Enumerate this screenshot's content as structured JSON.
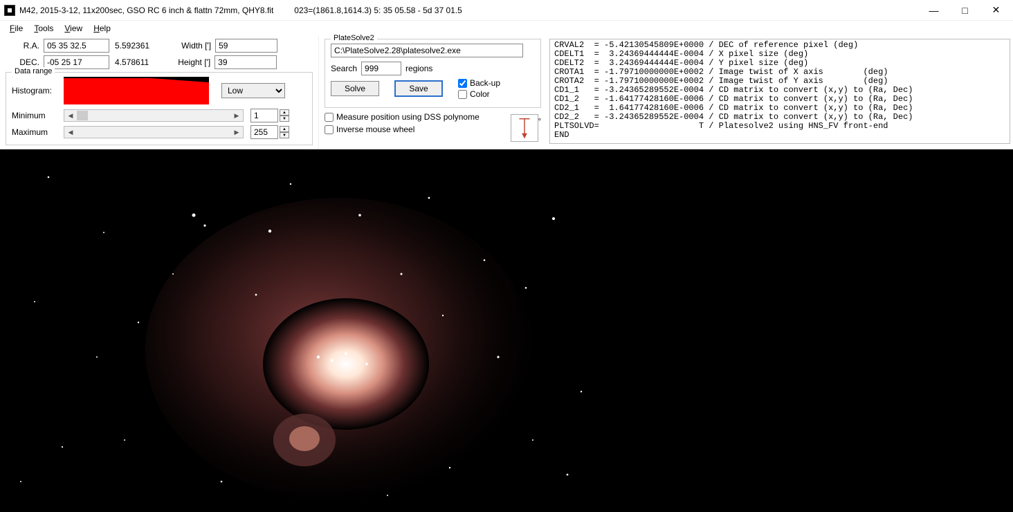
{
  "titlebar": {
    "filename": "M42, 2015-3-12,  11x200sec, GSO RC 6 inch & flattn 72mm, QHY8.fit",
    "status": "023=(1861.8,1614.3)    5: 35  05.58   - 5d 37  01.5"
  },
  "menu": {
    "file": "File",
    "tools": "Tools",
    "view": "View",
    "help": "Help"
  },
  "coords": {
    "ra_label": "R.A.",
    "ra_value": "05 35 32.5",
    "ra_decimal": "5.592361",
    "dec_label": "DEC.",
    "dec_value": "-05 25 17",
    "dec_decimal": "4.578611",
    "width_label": "Width [']",
    "width_value": "59",
    "height_label": "Height [']",
    "height_value": "39"
  },
  "datarange": {
    "legend": "Data range",
    "histogram_label": "Histogram:",
    "stretch_value": "Low",
    "min_label": "Minimum",
    "min_value": "1",
    "max_label": "Maximum",
    "max_value": "255"
  },
  "platesolve": {
    "legend": "PlateSolve2",
    "path": "C:\\PlateSolve2.28\\platesolve2.exe",
    "search_label": "Search",
    "search_value": "999",
    "regions_label": "regions",
    "solve_btn": "Solve",
    "save_btn": "Save",
    "backup_label": "Back-up",
    "backup_checked": true,
    "color_label": "Color",
    "color_checked": false,
    "dss_label": "Measure position using DSS polynome",
    "dss_checked": false,
    "inverse_label": "Inverse mouse wheel",
    "inverse_checked": false,
    "rotation": "-180°"
  },
  "fits_header": "CRVAL2  = -5.42130545809E+0000 / DEC of reference pixel (deg)\nCDELT1  =  3.24369444444E-0004 / X pixel size (deg)\nCDELT2  =  3.24369444444E-0004 / Y pixel size (deg)\nCROTA1  = -1.79710000000E+0002 / Image twist of X axis        (deg)\nCROTA2  = -1.79710000000E+0002 / Image twist of Y axis        (deg)\nCD1_1   = -3.24365289552E-0004 / CD matrix to convert (x,y) to (Ra, Dec)\nCD1_2   = -1.64177428160E-0006 / CD matrix to convert (x,y) to (Ra, Dec)\nCD2_1   =  1.64177428160E-0006 / CD matrix to convert (x,y) to (Ra, Dec)\nCD2_2   = -3.24365289552E-0004 / CD matrix to convert (x,y) to (Ra, Dec)\nPLTSOLVD=                    T / Platesolve2 using HNS_FV front-end\nEND"
}
